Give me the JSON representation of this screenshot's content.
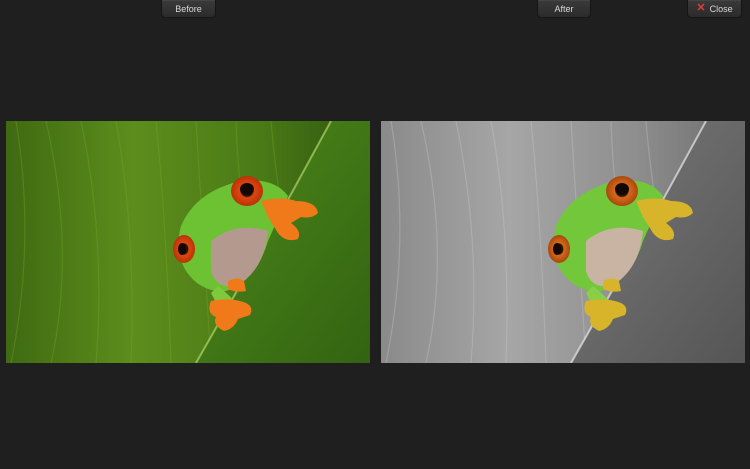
{
  "toolbar": {
    "before_label": "Before",
    "after_label": "After",
    "close_label": "Close",
    "close_icon": "close-icon"
  },
  "colors": {
    "background": "#1f1f1f",
    "close_icon": "#e03c3c",
    "button_text": "#d8d8d8"
  }
}
